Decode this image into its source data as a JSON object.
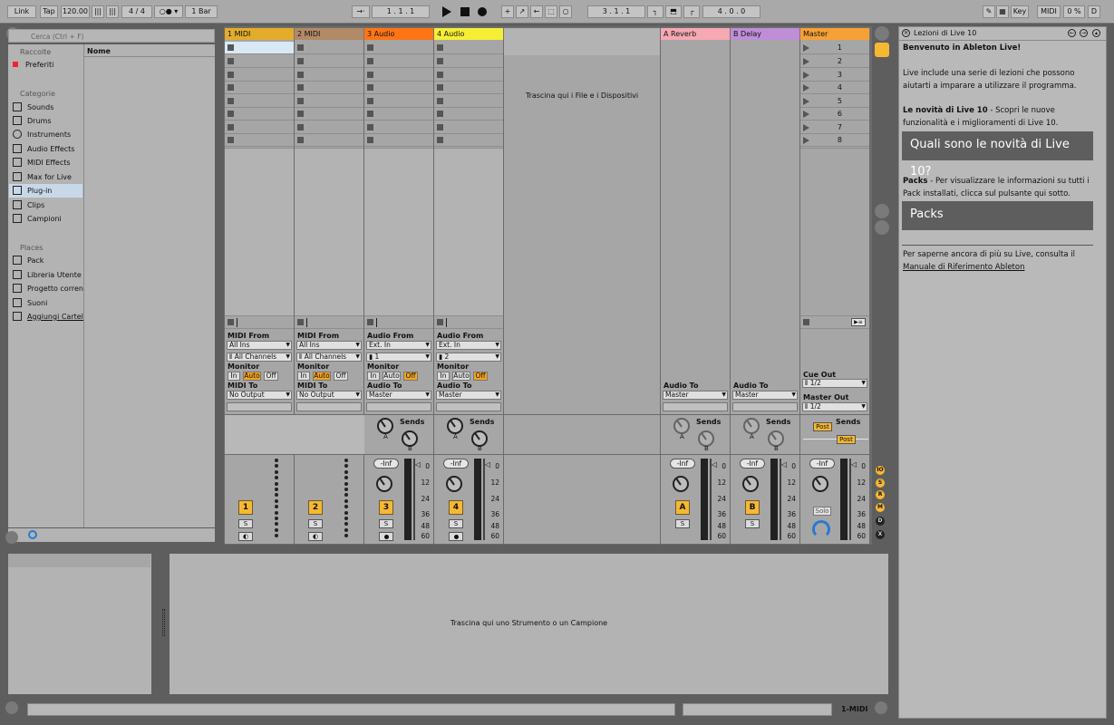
{
  "topbar": {
    "link": "Link",
    "tap": "Tap",
    "tempo": "120.00",
    "meter": "4 / 4",
    "quantize": "1 Bar",
    "position": "1 .   1 .   1",
    "loop_start": "3 .   1 .   1",
    "loop_length": "4 .   0 .   0",
    "key": "Key",
    "midi": "MIDI",
    "cpu": "0 %",
    "d": "D"
  },
  "browser": {
    "search_placeholder": "Cerca (Ctrl + F)",
    "col_header": "Nome",
    "collections_head": "Raccolte",
    "favorites": "Preferiti",
    "categories_head": "Categorie",
    "categories": [
      "Sounds",
      "Drums",
      "Instruments",
      "Audio Effects",
      "MIDI Effects",
      "Max for Live",
      "Plug-in",
      "Clips",
      "Campioni"
    ],
    "places_head": "Places",
    "places": [
      "Pack",
      "Libreria Utente",
      "Progetto corrente",
      "Suoni",
      "Aggiungi Cartella..."
    ]
  },
  "tracks": [
    {
      "name": "1 MIDI",
      "color": "#e3ac2a",
      "kind": "midi",
      "from_label": "MIDI From",
      "from": "All Ins",
      "channel": "All Channels",
      "to_label": "MIDI To",
      "to": "No Output",
      "number": "1"
    },
    {
      "name": "2 MIDI",
      "color": "#b28a67",
      "kind": "midi",
      "from_label": "MIDI From",
      "from": "All Ins",
      "channel": "All Channels",
      "to_label": "MIDI To",
      "to": "No Output",
      "number": "2"
    },
    {
      "name": "3 Audio",
      "color": "#ff7514",
      "kind": "audio",
      "from_label": "Audio From",
      "from": "Ext. In",
      "channel": "1",
      "to_label": "Audio To",
      "to": "Master",
      "number": "3"
    },
    {
      "name": "4 Audio",
      "color": "#f6ee35",
      "kind": "audio",
      "from_label": "Audio From",
      "from": "Ext. In",
      "channel": "2",
      "to_label": "Audio To",
      "to": "Master",
      "number": "4"
    }
  ],
  "returns": [
    {
      "name": "A Reverb",
      "color": "#f6a8b3",
      "to_label": "Audio To",
      "to": "Master",
      "letter": "A"
    },
    {
      "name": "B Delay",
      "color": "#c08ed9",
      "to_label": "Audio To",
      "to": "Master",
      "letter": "B"
    }
  ],
  "master": {
    "name": "Master",
    "color": "#f6a136",
    "scenes": [
      "1",
      "2",
      "3",
      "4",
      "5",
      "6",
      "7",
      "8"
    ],
    "cue_label": "Cue Out",
    "cue": "1/2",
    "out_label": "Master Out",
    "out": "1/2",
    "post": "Post",
    "solo": "Solo"
  },
  "mixer": {
    "monitor": "Monitor",
    "mon_in": "In",
    "mon_auto": "Auto",
    "mon_off": "Off",
    "sends": "Sends",
    "inf": "-Inf",
    "solo": "S",
    "scale": [
      "0",
      "12",
      "24",
      "36",
      "48",
      "60"
    ],
    "knob_a": "A",
    "knob_b": "B"
  },
  "drop_files": "Trascina qui i File e i Dispositivi",
  "drop_instrument": "Trascina qui uno Strumento o un Campione",
  "status_track": "1-MIDI",
  "help": {
    "title": "Lezioni di Live 10",
    "welcome": "Benvenuto in Ableton Live!",
    "intro": "Live include una serie di lezioni che possono aiutarti a imparare a utilizzare il programma.",
    "news_bold": "Le novità di Live 10",
    "news_text": " - Scopri le nuove funzionalità e i miglioramenti di Live 10.",
    "news_button": "Quali sono le novità di Live 10?",
    "packs_bold": "Packs",
    "packs_text": " - Per visualizzare le informazioni su tutti i Pack installati, clicca sul pulsante qui sotto.",
    "packs_button": "Packs",
    "more_text": "Per saperne ancora di più su Live, consulta il",
    "manual_link": "Manuale di Riferimento Ableton"
  },
  "colors": {
    "accent_yellow": "#f6b833",
    "panel": "#a8a8a8",
    "dark": "#5e5e5e"
  }
}
